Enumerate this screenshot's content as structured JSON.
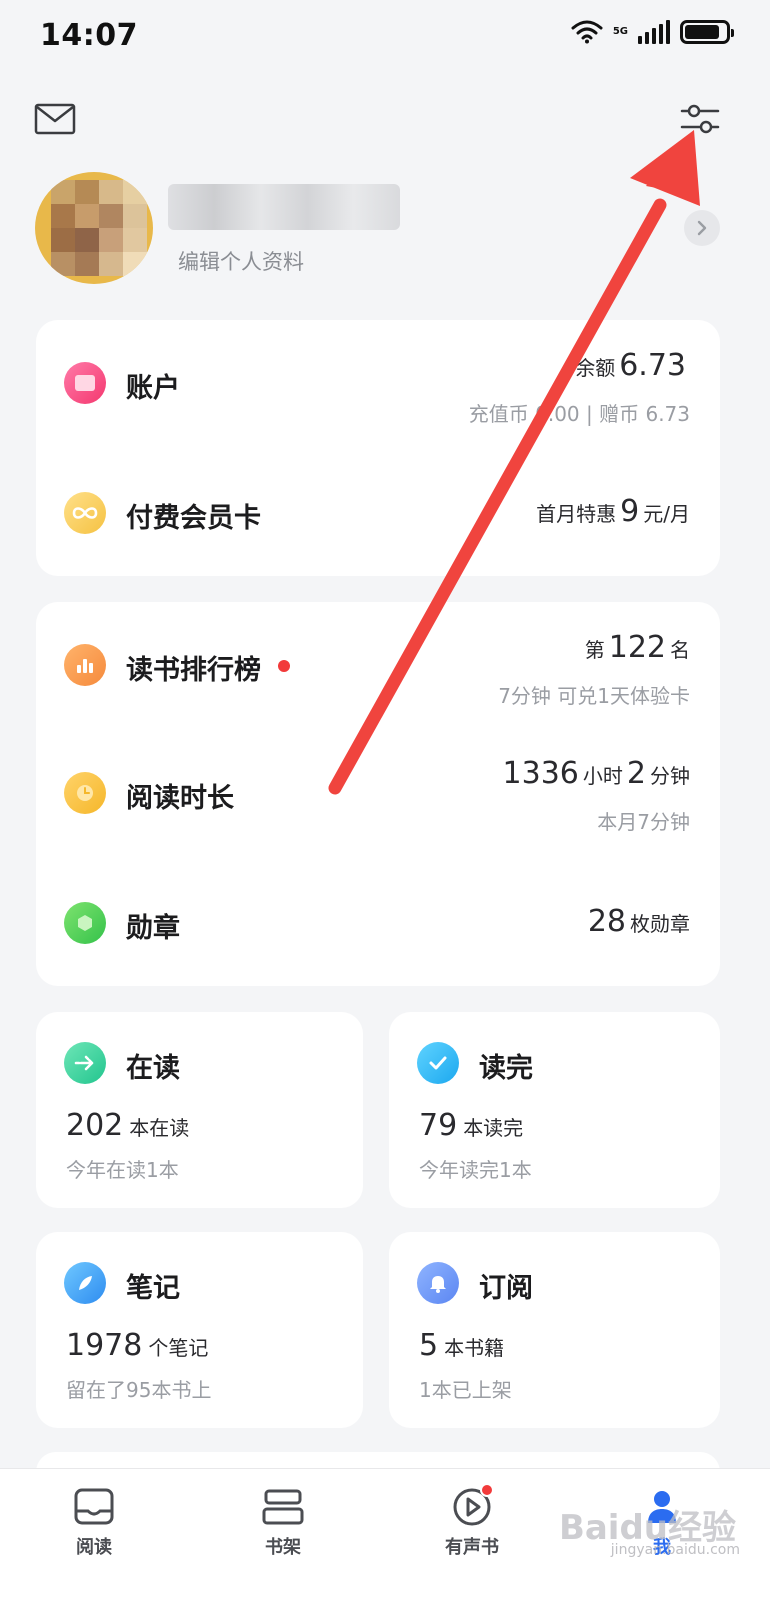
{
  "status_bar": {
    "time": "14:07",
    "network": "5G",
    "battery_level": 0.85
  },
  "profile": {
    "edit_label": "编辑个人资料"
  },
  "account_card": {
    "account": {
      "title": "账户",
      "balance_prefix": "余额",
      "balance_value": "6.73",
      "sub": "充值币 0.00 | 赠币 6.73"
    },
    "membership": {
      "title": "付费会员卡",
      "prefix": "首月特惠",
      "price": "9",
      "unit": "元/月"
    }
  },
  "stats_card": {
    "ranking": {
      "title": "读书排行榜",
      "prefix": "第",
      "rank": "122",
      "suffix": "名",
      "sub": "7分钟 可兑1天体验卡"
    },
    "reading_time": {
      "title": "阅读时长",
      "hours": "1336",
      "hours_unit": "小时",
      "minutes": "2",
      "minutes_unit": "分钟",
      "sub": "本月7分钟"
    },
    "medals": {
      "title": "勋章",
      "count": "28",
      "unit": "枚勋章"
    }
  },
  "tiles": {
    "reading": {
      "title": "在读",
      "count": "202",
      "unit": "本在读",
      "sub": "今年在读1本"
    },
    "finished": {
      "title": "读完",
      "count": "79",
      "unit": "本读完",
      "sub": "今年读完1本"
    },
    "notes": {
      "title": "笔记",
      "count": "1978",
      "unit": "个笔记",
      "sub": "留在了95本书上"
    },
    "subscriptions": {
      "title": "订阅",
      "count": "5",
      "unit": "本书籍",
      "sub": "1本已上架"
    }
  },
  "bottom_nav": {
    "items": [
      {
        "label": "阅读",
        "icon": "book-open-icon"
      },
      {
        "label": "书架",
        "icon": "bookshelf-icon"
      },
      {
        "label": "有声书",
        "icon": "audiobook-play-icon"
      },
      {
        "label": "我",
        "icon": "person-icon"
      }
    ]
  },
  "watermark": {
    "brand": "Baidu经验",
    "url": "jingyan.baidu.com"
  },
  "colors": {
    "background": "#f4f5f7",
    "card": "#ffffff",
    "accent_blue": "#2b6cf0",
    "annotation_red": "#f0443e",
    "badge_red": "#f23a3a"
  }
}
